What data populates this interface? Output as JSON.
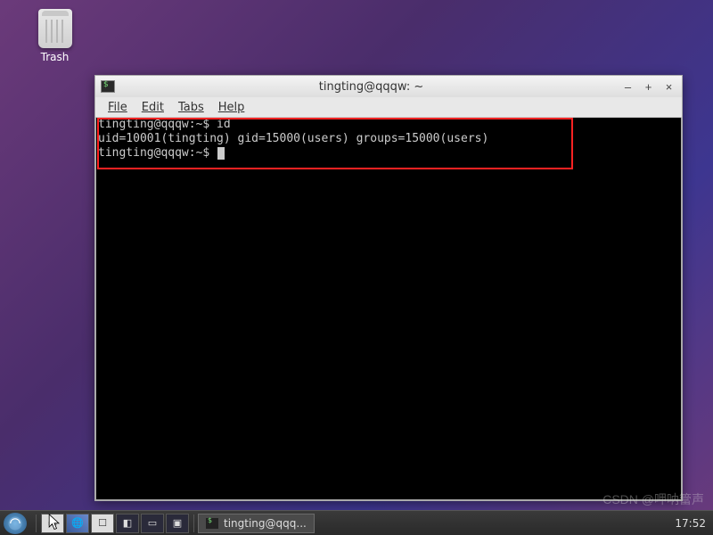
{
  "desktop": {
    "trash_label": "Trash"
  },
  "window": {
    "title": "tingting@qqqw: ~",
    "menus": {
      "file": "File",
      "edit": "Edit",
      "tabs": "Tabs",
      "help": "Help"
    },
    "controls": {
      "min": "–",
      "max": "+",
      "close": "×"
    }
  },
  "terminal": {
    "line1": "tingting@qqqw:~$ id",
    "line2": "uid=10001(tingting) gid=15000(users) groups=15000(users)",
    "line3": "tingting@qqqw:~$ "
  },
  "taskbar": {
    "entry1": "tingting@qqq...",
    "clock": "17:52"
  },
  "watermark": "CSDN @呷呐簹声"
}
